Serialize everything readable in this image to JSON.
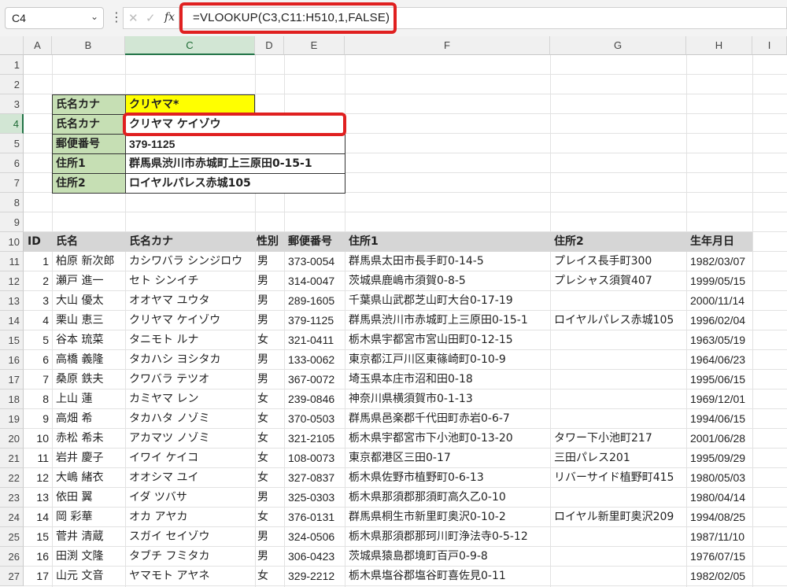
{
  "formula_bar": {
    "name_box": "C4",
    "formula": "=VLOOKUP(C3,C11:H510,1,FALSE)",
    "fx_label": "fx"
  },
  "columns": [
    "A",
    "B",
    "C",
    "D",
    "E",
    "F",
    "G",
    "H",
    "I"
  ],
  "rows": [
    "1",
    "2",
    "3",
    "4",
    "5",
    "6",
    "7",
    "8",
    "9",
    "10",
    "11",
    "12",
    "13",
    "14",
    "15",
    "16",
    "17",
    "18",
    "19",
    "20",
    "21",
    "22",
    "23",
    "24",
    "25",
    "26",
    "27"
  ],
  "lookup": {
    "r3": {
      "label": "氏名カナ",
      "value": "クリヤマ*"
    },
    "r4": {
      "label": "氏名カナ",
      "value": "クリヤマ ケイゾウ"
    },
    "r5": {
      "label": "郵便番号",
      "value": "379-1125"
    },
    "r6": {
      "label": "住所1",
      "value": "群馬県渋川市赤城町上三原田0-15-1"
    },
    "r7": {
      "label": "住所2",
      "value": "ロイヤルパレス赤城105"
    }
  },
  "table": {
    "headers": [
      "ID",
      "氏名",
      "氏名カナ",
      "性別",
      "郵便番号",
      "住所1",
      "住所2",
      "生年月日"
    ],
    "rows": [
      [
        "1",
        "柏原 新次郎",
        "カシワバラ シンジロウ",
        "男",
        "373-0054",
        "群馬県太田市長手町0-14-5",
        "プレイス長手町300",
        "1982/03/07"
      ],
      [
        "2",
        "瀬戸 進一",
        "セト シンイチ",
        "男",
        "314-0047",
        "茨城県鹿嶋市須賀0-8-5",
        "プレシャス須賀407",
        "1999/05/15"
      ],
      [
        "3",
        "大山 優太",
        "オオヤマ ユウタ",
        "男",
        "289-1605",
        "千葉県山武郡芝山町大台0-17-19",
        "",
        "2000/11/14"
      ],
      [
        "4",
        "栗山 恵三",
        "クリヤマ ケイゾウ",
        "男",
        "379-1125",
        "群馬県渋川市赤城町上三原田0-15-1",
        "ロイヤルパレス赤城105",
        "1996/02/04"
      ],
      [
        "5",
        "谷本 琉菜",
        "タニモト ルナ",
        "女",
        "321-0411",
        "栃木県宇都宮市宮山田町0-12-15",
        "",
        "1963/05/19"
      ],
      [
        "6",
        "高橋 義隆",
        "タカハシ ヨシタカ",
        "男",
        "133-0062",
        "東京都江戸川区東篠崎町0-10-9",
        "",
        "1964/06/23"
      ],
      [
        "7",
        "桑原 鉄夫",
        "クワバラ テツオ",
        "男",
        "367-0072",
        "埼玉県本庄市沼和田0-18",
        "",
        "1995/06/15"
      ],
      [
        "8",
        "上山 蓮",
        "カミヤマ レン",
        "女",
        "239-0846",
        "神奈川県横須賀市0-1-13",
        "",
        "1969/12/01"
      ],
      [
        "9",
        "高畑 希",
        "タカハタ ノゾミ",
        "女",
        "370-0503",
        "群馬県邑楽郡千代田町赤岩0-6-7",
        "",
        "1994/06/15"
      ],
      [
        "10",
        "赤松 希未",
        "アカマツ ノゾミ",
        "女",
        "321-2105",
        "栃木県宇都宮市下小池町0-13-20",
        "タワー下小池町217",
        "2001/06/28"
      ],
      [
        "11",
        "岩井 慶子",
        "イワイ ケイコ",
        "女",
        "108-0073",
        "東京都港区三田0-17",
        "三田パレス201",
        "1995/09/29"
      ],
      [
        "12",
        "大嶋 緒衣",
        "オオシマ ユイ",
        "女",
        "327-0837",
        "栃木県佐野市植野町0-6-13",
        "リバーサイド植野町415",
        "1980/05/03"
      ],
      [
        "13",
        "依田 翼",
        "イダ ツバサ",
        "男",
        "325-0303",
        "栃木県那須郡那須町高久乙0-10",
        "",
        "1980/04/14"
      ],
      [
        "14",
        "岡 彩華",
        "オカ アヤカ",
        "女",
        "376-0131",
        "群馬県桐生市新里町奥沢0-10-2",
        "ロイヤル新里町奥沢209",
        "1994/08/25"
      ],
      [
        "15",
        "菅井 清蔵",
        "スガイ セイゾウ",
        "男",
        "324-0506",
        "栃木県那須郡那珂川町浄法寺0-5-12",
        "",
        "1987/11/10"
      ],
      [
        "16",
        "田渕 文隆",
        "タブチ フミタカ",
        "男",
        "306-0423",
        "茨城県猿島郡境町百戸0-9-8",
        "",
        "1976/07/15"
      ],
      [
        "17",
        "山元 文音",
        "ヤマモト アヤネ",
        "女",
        "329-2212",
        "栃木県塩谷郡塩谷町喜佐見0-11",
        "",
        "1982/02/05"
      ]
    ]
  }
}
